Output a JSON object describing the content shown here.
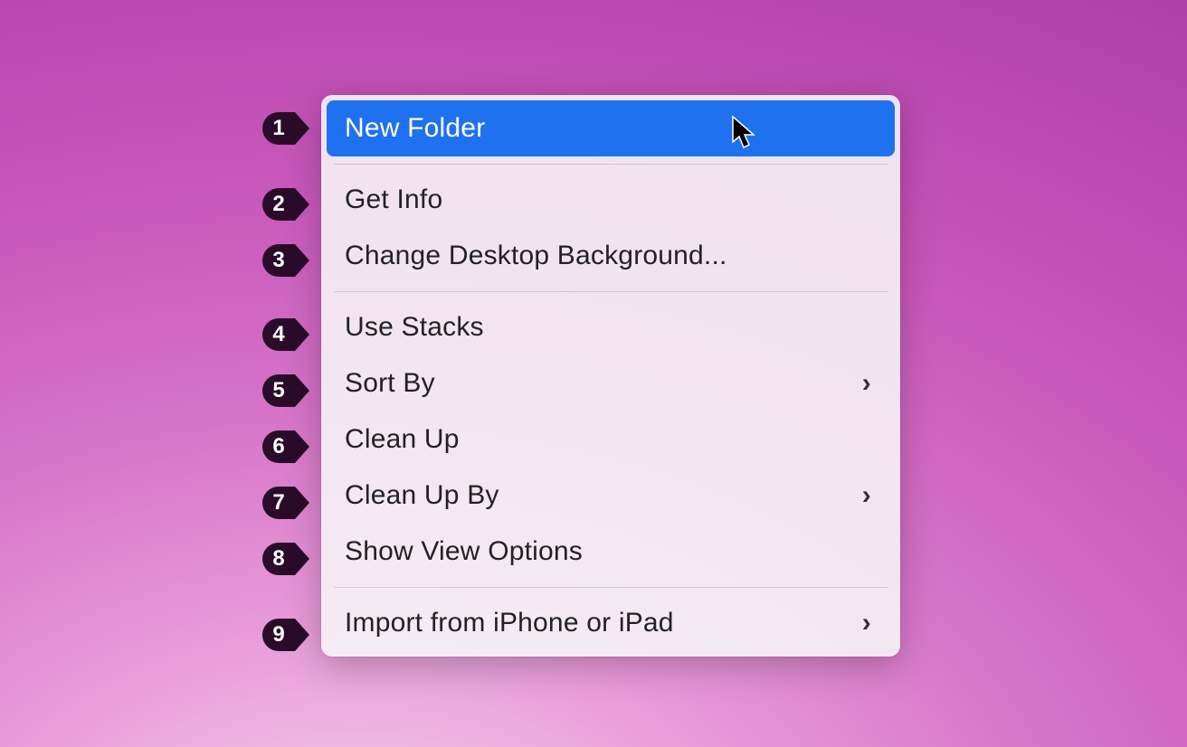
{
  "menu": {
    "items": [
      {
        "label": "New Folder",
        "highlighted": true,
        "submenu": false,
        "badge": "1"
      },
      {
        "label": "Get Info",
        "highlighted": false,
        "submenu": false,
        "badge": "2"
      },
      {
        "label": "Change Desktop Background...",
        "highlighted": false,
        "submenu": false,
        "badge": "3"
      },
      {
        "label": "Use Stacks",
        "highlighted": false,
        "submenu": false,
        "badge": "4"
      },
      {
        "label": "Sort By",
        "highlighted": false,
        "submenu": true,
        "badge": "5"
      },
      {
        "label": "Clean Up",
        "highlighted": false,
        "submenu": false,
        "badge": "6"
      },
      {
        "label": "Clean Up By",
        "highlighted": false,
        "submenu": true,
        "badge": "7"
      },
      {
        "label": "Show View Options",
        "highlighted": false,
        "submenu": false,
        "badge": "8"
      },
      {
        "label": "Import from iPhone or iPad",
        "highlighted": false,
        "submenu": true,
        "badge": "9"
      }
    ],
    "separators_after": [
      0,
      2,
      7
    ]
  },
  "colors": {
    "highlight": "#1f71f0",
    "badge_fill": "#2a0c2a"
  }
}
